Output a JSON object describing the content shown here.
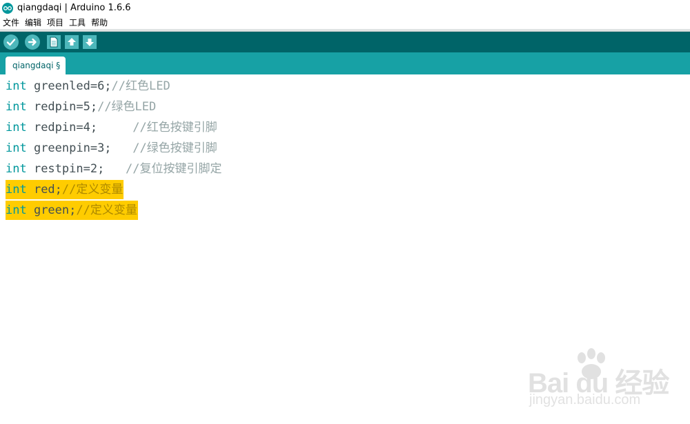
{
  "window": {
    "title": "qiangdaqi | Arduino 1.6.6"
  },
  "menu": [
    "文件",
    "编辑",
    "项目",
    "工具",
    "帮助"
  ],
  "toolbar": {
    "buttons": [
      "verify-icon",
      "upload-icon",
      "new-icon",
      "open-icon",
      "save-icon"
    ]
  },
  "tab": {
    "label": "qiangdaqi §"
  },
  "colors": {
    "toolbar_bg": "#006468",
    "tabbar_bg": "#17a1a5",
    "keyword": "#00979c",
    "highlight": "#ffcc00"
  },
  "code": [
    {
      "keyword": "int",
      "body": " greenled=6;",
      "comment": "//红色LED",
      "highlighted": false
    },
    {
      "keyword": "int",
      "body": " redpin=5;",
      "comment": "//绿色LED",
      "highlighted": false
    },
    {
      "keyword": "int",
      "body": " redpin=4;     ",
      "comment": "//红色按键引脚",
      "highlighted": false
    },
    {
      "keyword": "int",
      "body": " greenpin=3;   ",
      "comment": "//绿色按键引脚",
      "highlighted": false
    },
    {
      "keyword": "int",
      "body": " restpin=2;   ",
      "comment": "//复位按键引脚定",
      "highlighted": false
    },
    {
      "keyword": "int",
      "body": " red;",
      "comment": "//定义变量",
      "highlighted": true
    },
    {
      "keyword": "int",
      "body": " green;",
      "comment": "//定义变量",
      "highlighted": true
    }
  ],
  "watermark": {
    "brand": "Bai du 经验",
    "url": "jingyan.baidu.com"
  }
}
